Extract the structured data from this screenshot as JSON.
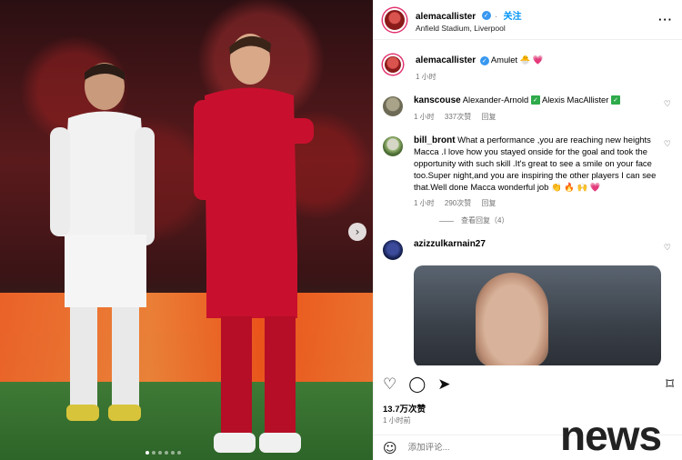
{
  "post": {
    "username": "alemacallister",
    "follow_label": "关注",
    "location": "Anfield Stadium, Liverpool",
    "more_label": "···",
    "caption_username": "alemacallister",
    "caption_text": "Amulet 🐣 💗",
    "caption_time": "1 小时",
    "next_arrow": "›",
    "likes": "13.7万次赞",
    "time": "1 小时前",
    "add_comment_placeholder": "添加评论...",
    "watermark": "news"
  },
  "comments": [
    {
      "username": "kanscouse",
      "text_before": "Alexander-Arnold",
      "text_mid": "Alexis MacAllister",
      "time": "1 小时",
      "likes": "337次赞",
      "reply": "回复"
    },
    {
      "username": "bill_bront",
      "text": "What a performance ,you are reaching new heights Macca .I love how you stayed onside for the goal and took the opportunity with such skill .It's great to see a smile on your face too.Super night,and you are inspiring the other players I can see that.Well done Macca wonderful job 👏 🔥 🙌 💗",
      "time": "1 小时",
      "likes": "290次赞",
      "reply": "回复",
      "view_replies": "查看回复（4）"
    },
    {
      "username": "azizzulkarnain27"
    }
  ],
  "icons": {
    "heart": "♡",
    "comment": "◯",
    "share": "➤",
    "bookmark": "⌑",
    "emoji": "☺",
    "check": "✓",
    "verified": "✓"
  },
  "colors": {
    "accent_blue": "#0095f6",
    "verified_blue": "#3897f0",
    "green_check": "#2eaa4a",
    "liverpool_red": "#c8102e"
  }
}
